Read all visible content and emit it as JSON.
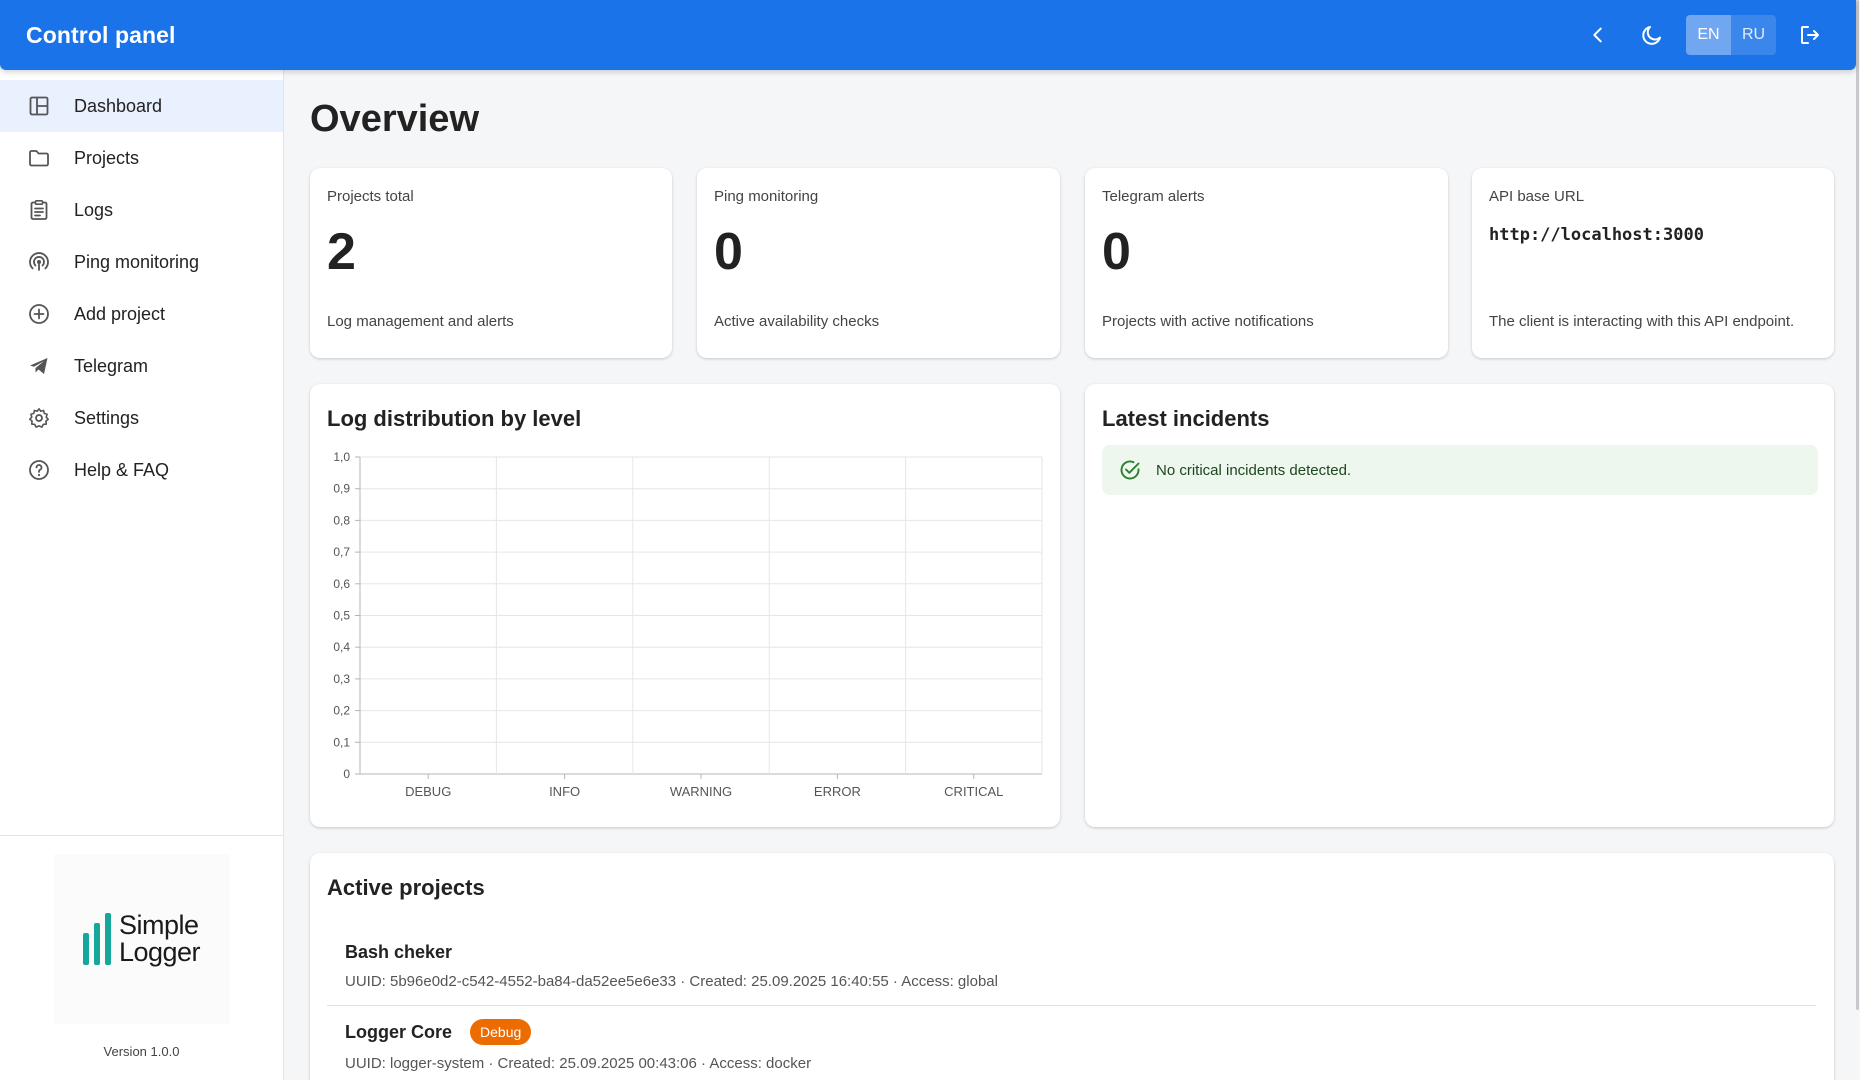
{
  "appbar": {
    "title": "Control panel",
    "collapse_icon": "chevron-left-icon",
    "theme_icon": "moon-icon",
    "languages": [
      "EN",
      "RU"
    ],
    "active_language": "EN",
    "logout_icon": "logout-icon"
  },
  "sidebar": {
    "items": [
      {
        "label": "Dashboard",
        "icon": "dashboard-icon",
        "active": true
      },
      {
        "label": "Projects",
        "icon": "folder-icon"
      },
      {
        "label": "Logs",
        "icon": "clipboard-list-icon"
      },
      {
        "label": "Ping monitoring",
        "icon": "broadcast-icon"
      },
      {
        "label": "Add project",
        "icon": "add-circle-icon"
      },
      {
        "label": "Telegram",
        "icon": "telegram-icon"
      },
      {
        "label": "Settings",
        "icon": "gear-icon"
      },
      {
        "label": "Help & FAQ",
        "icon": "help-circle-icon"
      }
    ],
    "logo": {
      "line1": "Simple",
      "line2": "Logger"
    },
    "version": "Version 1.0.0"
  },
  "main": {
    "title": "Overview",
    "stats": [
      {
        "label": "Projects total",
        "value": "2",
        "description": "Log management and alerts"
      },
      {
        "label": "Ping monitoring",
        "value": "0",
        "description": "Active availability checks"
      },
      {
        "label": "Telegram alerts",
        "value": "0",
        "description": "Projects with active notifications"
      },
      {
        "label": "API base URL",
        "value": "http://localhost:3000",
        "description": "The client is interacting with this API endpoint."
      }
    ],
    "log_chart": {
      "title": "Log distribution by level"
    },
    "incidents": {
      "title": "Latest incidents",
      "message": "No critical incidents detected."
    },
    "projects": {
      "title": "Active projects",
      "items": [
        {
          "name": "Bash cheker",
          "badge": "",
          "meta": "UUID: 5b96e0d2-c542-4552-ba84-da52ee5e6e33 · Created: 25.09.2025 16:40:55 · Access: global"
        },
        {
          "name": "Logger Core",
          "badge": "Debug",
          "meta": "UUID: logger-system · Created: 25.09.2025 00:43:06 · Access: docker"
        }
      ]
    }
  },
  "colors": {
    "primary": "#1a73e8",
    "logo_accent": "#15a89a",
    "success_bg": "#edf7ed",
    "success_icon": "#2e7d32",
    "badge_debug": "#ed6c02"
  },
  "chart_data": {
    "type": "bar",
    "categories": [
      "DEBUG",
      "INFO",
      "WARNING",
      "ERROR",
      "CRITICAL"
    ],
    "values": [
      0,
      0,
      0,
      0,
      0
    ],
    "yticks": [
      "0",
      "0,1",
      "0,2",
      "0,3",
      "0,4",
      "0,5",
      "0,6",
      "0,7",
      "0,8",
      "0,9",
      "1,0"
    ],
    "ylim": [
      0,
      1
    ],
    "grid": true
  }
}
